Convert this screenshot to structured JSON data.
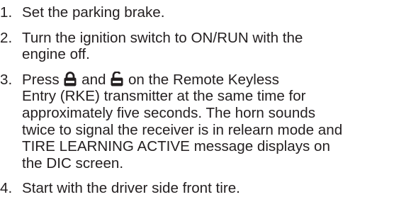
{
  "steps": [
    {
      "number": "1.",
      "lines": [
        "Set the parking brake."
      ]
    },
    {
      "number": "2.",
      "lines": [
        "Turn the ignition switch to ON/RUN with the",
        "engine off."
      ]
    },
    {
      "number": "3.",
      "first_line": {
        "prefix": "Press",
        "lock_icon": "lock-icon",
        "middle": "and",
        "unlock_icon": "unlock-icon",
        "suffix": "on the Remote Keyless"
      },
      "lines": [
        "Entry (RKE) transmitter at the same time for",
        "approximately five seconds. The horn sounds",
        "twice to signal the receiver is in relearn mode and",
        "TIRE LEARNING ACTIVE message displays on",
        "the DIC screen."
      ]
    },
    {
      "number": "4.",
      "lines": [
        "Start with the driver side front tire."
      ]
    }
  ],
  "colors": {
    "text": "#231f20",
    "background": "#ffffff"
  }
}
